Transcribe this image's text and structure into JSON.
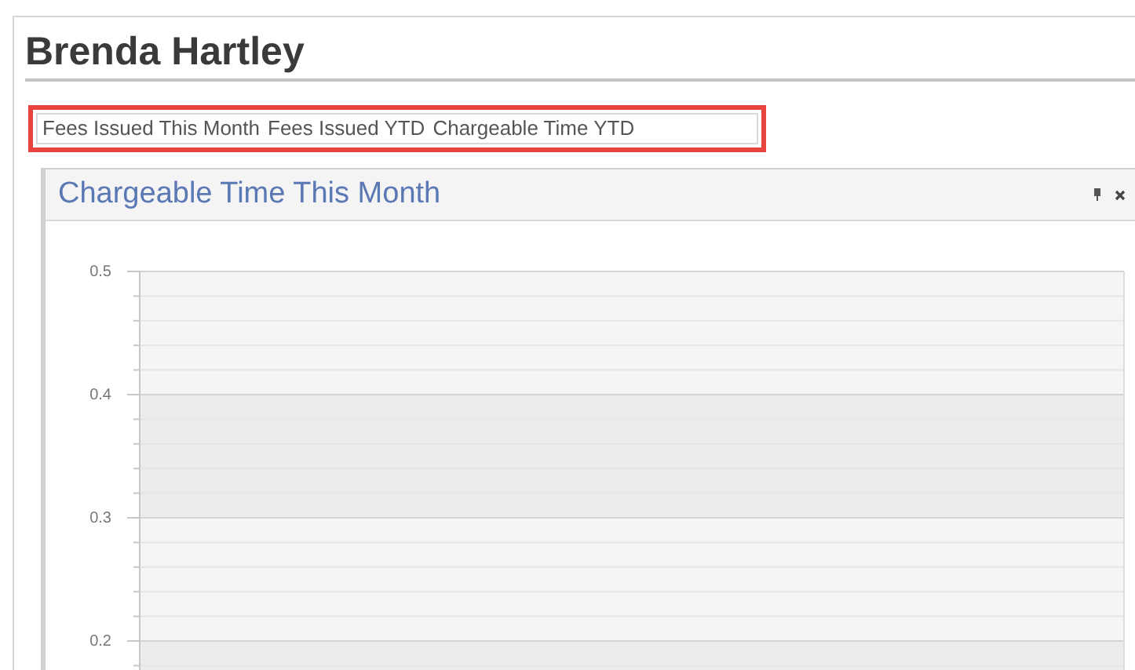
{
  "page": {
    "title": "Brenda Hartley"
  },
  "tabs": [
    {
      "label": "Fees Issued This Month"
    },
    {
      "label": "Fees Issued YTD"
    },
    {
      "label": "Chargeable Time YTD"
    }
  ],
  "panel": {
    "title": "Chargeable Time This Month",
    "y_axis_labels": [
      "0.5",
      "0.4",
      "0.3",
      "0.2"
    ]
  }
}
